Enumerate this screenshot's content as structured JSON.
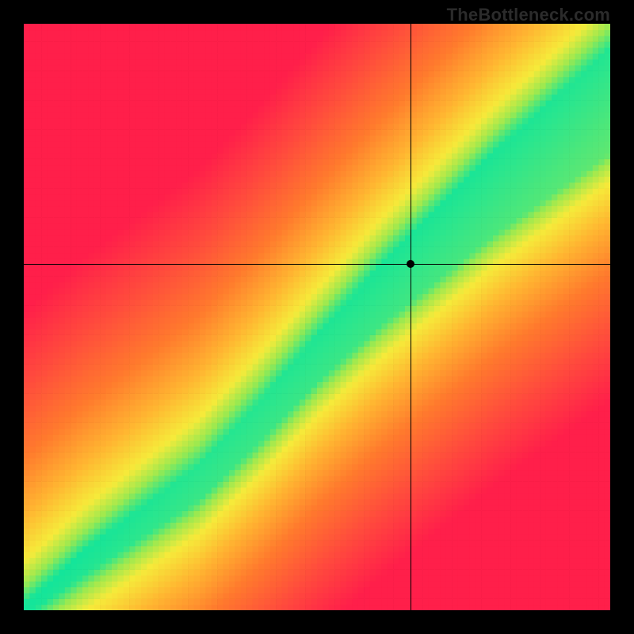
{
  "watermark": "TheBottleneck.com",
  "chart_data": {
    "type": "heatmap",
    "title": "",
    "xlabel": "",
    "ylabel": "",
    "xlim": [
      0,
      100
    ],
    "ylim": [
      0,
      100
    ],
    "crosshair": {
      "x": 66,
      "y": 59
    },
    "marker": {
      "x": 66,
      "y": 59
    },
    "optimal_band": {
      "description": "green diagonal ridge where the two axes are balanced; band widens toward top-right",
      "samples": [
        {
          "x": 0,
          "center": 0,
          "halfwidth": 1
        },
        {
          "x": 10,
          "center": 8,
          "halfwidth": 2
        },
        {
          "x": 20,
          "center": 15,
          "halfwidth": 2.5
        },
        {
          "x": 30,
          "center": 22,
          "halfwidth": 3
        },
        {
          "x": 40,
          "center": 32,
          "halfwidth": 3.5
        },
        {
          "x": 50,
          "center": 43,
          "halfwidth": 4
        },
        {
          "x": 60,
          "center": 53,
          "halfwidth": 5
        },
        {
          "x": 70,
          "center": 62,
          "halfwidth": 6
        },
        {
          "x": 80,
          "center": 71,
          "halfwidth": 7
        },
        {
          "x": 90,
          "center": 79,
          "halfwidth": 8
        },
        {
          "x": 100,
          "center": 87,
          "halfwidth": 9
        }
      ]
    },
    "color_scale": {
      "description": "distance from optimal ridge → color",
      "stops": [
        {
          "d": 0.0,
          "color": "#14e59a"
        },
        {
          "d": 0.07,
          "color": "#9de94f"
        },
        {
          "d": 0.15,
          "color": "#f6ea3a"
        },
        {
          "d": 0.3,
          "color": "#ffb531"
        },
        {
          "d": 0.5,
          "color": "#ff7a2d"
        },
        {
          "d": 0.75,
          "color": "#ff4a3d"
        },
        {
          "d": 1.0,
          "color": "#ff1f4a"
        }
      ]
    },
    "grid_resolution": 100
  }
}
